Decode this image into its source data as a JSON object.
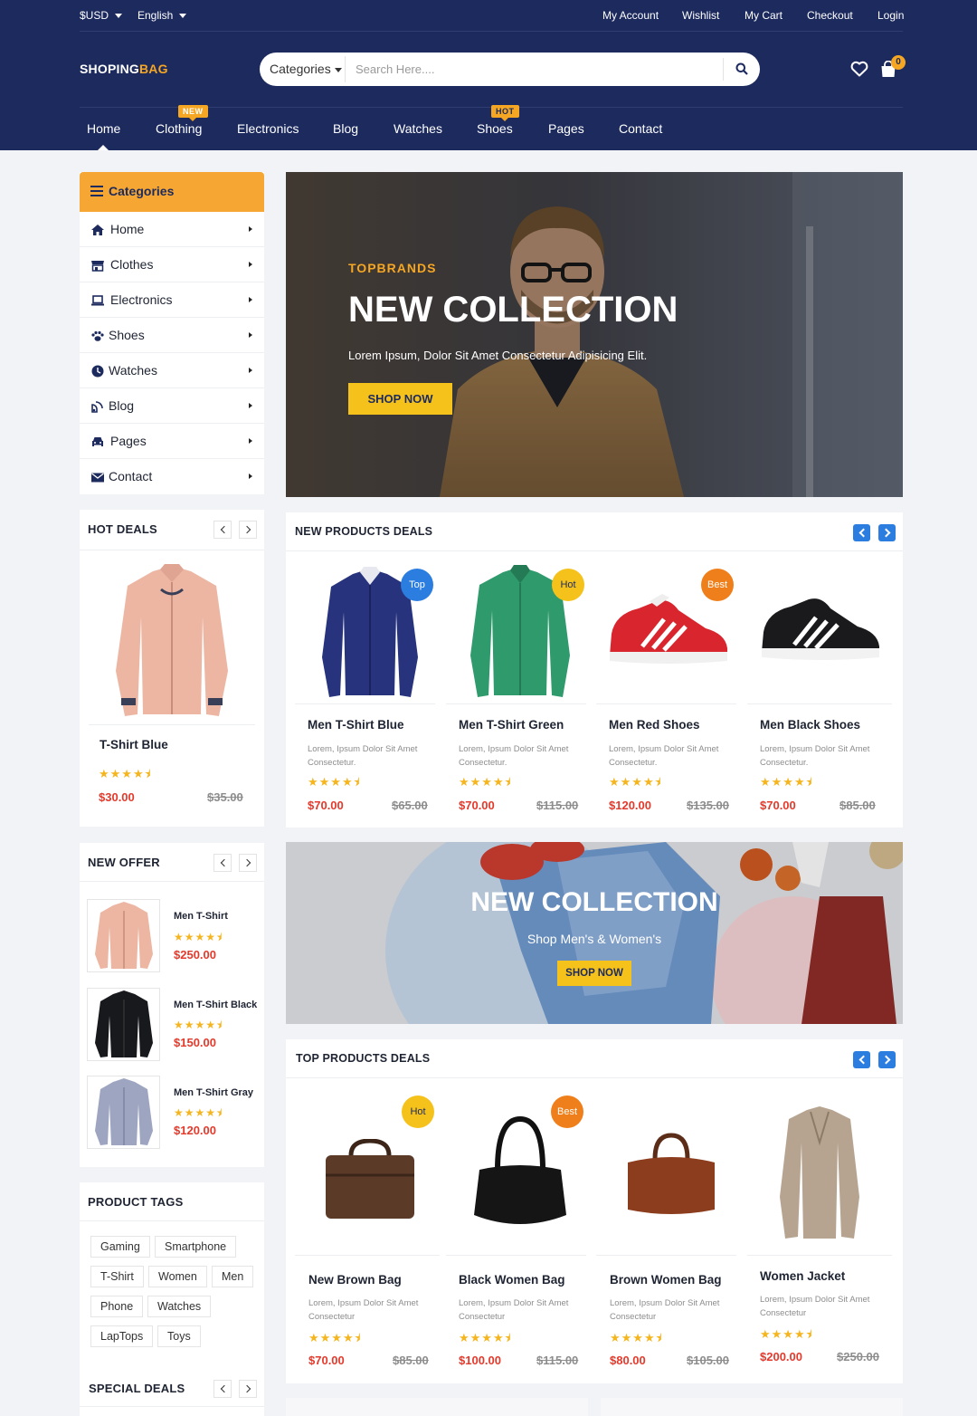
{
  "topbar": {
    "currency": "$USD",
    "language": "English",
    "links": [
      "My Account",
      "Wishlist",
      "My Cart",
      "Checkout",
      "Login"
    ]
  },
  "logo": {
    "part1": "SHOPING",
    "part2": "BAG"
  },
  "search": {
    "category": "Categories",
    "placeholder": "Search Here...."
  },
  "cart": {
    "count": "0"
  },
  "nav": {
    "items": [
      "Home",
      "Clothing",
      "Electronics",
      "Blog",
      "Watches",
      "Shoes",
      "Pages",
      "Contact"
    ],
    "badge_new": "NEW",
    "badge_hot": "HOT"
  },
  "categories": {
    "title": "Categories",
    "items": [
      "Home",
      "Clothes",
      "Electronics",
      "Shoes",
      "Watches",
      "Blog",
      "Pages",
      "Contact"
    ]
  },
  "hero": {
    "pretitle": "TOPBRANDS",
    "title": "NEW COLLECTION",
    "subtitle": "Lorem Ipsum, Dolor Sit Amet Consectetur Adipisicing Elit.",
    "button": "SHOP NOW"
  },
  "hot_deals": {
    "title": "HOT DEALS",
    "product": {
      "name": "T-Shirt Blue",
      "price": "$30.00",
      "old_price": "$35.00",
      "rating": 4.5
    }
  },
  "new_offer": {
    "title": "NEW OFFER",
    "items": [
      {
        "name": "Men T-Shirt",
        "price": "$250.00",
        "rating": 4.5
      },
      {
        "name": "Men T-Shirt Black",
        "price": "$150.00",
        "rating": 4.5
      },
      {
        "name": "Men T-Shirt Gray",
        "price": "$120.00",
        "rating": 4.5
      }
    ]
  },
  "product_tags": {
    "title": "PRODUCT TAGS",
    "tags": [
      "Gaming",
      "Smartphone",
      "T-Shirt",
      "Women",
      "Men",
      "Phone",
      "Watches",
      "LapTops",
      "Toys"
    ]
  },
  "special_deals": {
    "title": "SPECIAL DEALS"
  },
  "new_products": {
    "title": "NEW PRODUCTS DEALS",
    "items": [
      {
        "name": "Men T-Shirt Blue",
        "desc": "Lorem, Ipsum Dolor Sit Amet Consectetur.",
        "price": "$70.00",
        "old_price": "$65.00",
        "badge": "Top",
        "rating": 4.5
      },
      {
        "name": "Men T-Shirt Green",
        "desc": "Lorem, Ipsum Dolor Sit Amet Consectetur.",
        "price": "$70.00",
        "old_price": "$115.00",
        "badge": "Hot",
        "rating": 4.5
      },
      {
        "name": "Men Red Shoes",
        "desc": "Lorem, Ipsum Dolor Sit Amet Consectetur.",
        "price": "$120.00",
        "old_price": "$135.00",
        "badge": "Best",
        "rating": 4.5
      },
      {
        "name": "Men Black Shoes",
        "desc": "Lorem, Ipsum Dolor Sit Amet Consectetur.",
        "price": "$70.00",
        "old_price": "$85.00",
        "badge": "",
        "rating": 4.5
      }
    ]
  },
  "banner2": {
    "title": "NEW COLLECTION",
    "subtitle": "Shop Men's & Women's",
    "button": "SHOP NOW"
  },
  "top_products": {
    "title": "TOP PRODUCTS DEALS",
    "items": [
      {
        "name": "New Brown Bag",
        "desc": "Lorem, Ipsum Dolor Sit Amet Consectetur",
        "price": "$70.00",
        "old_price": "$85.00",
        "badge": "Hot",
        "rating": 4.5
      },
      {
        "name": "Black Women Bag",
        "desc": "Lorem, Ipsum Dolor Sit Amet Consectetur",
        "price": "$100.00",
        "old_price": "$115.00",
        "badge": "Best",
        "rating": 4.5
      },
      {
        "name": "Brown Women Bag",
        "desc": "Lorem, Ipsum Dolor Sit Amet Consectetur",
        "price": "$80.00",
        "old_price": "$105.00",
        "badge": "",
        "rating": 4.5
      },
      {
        "name": "Women Jacket",
        "desc": "Lorem, Ipsum Dolor Sit Amet Consectetur",
        "price": "$200.00",
        "old_price": "$250.00",
        "badge": "",
        "rating": 4.5
      }
    ]
  },
  "colors": {
    "header": "#1c2a5e",
    "accent": "#f5a623",
    "price": "#e33a2c",
    "star": "#f5b51e",
    "nav_button": "#2b7de0"
  }
}
